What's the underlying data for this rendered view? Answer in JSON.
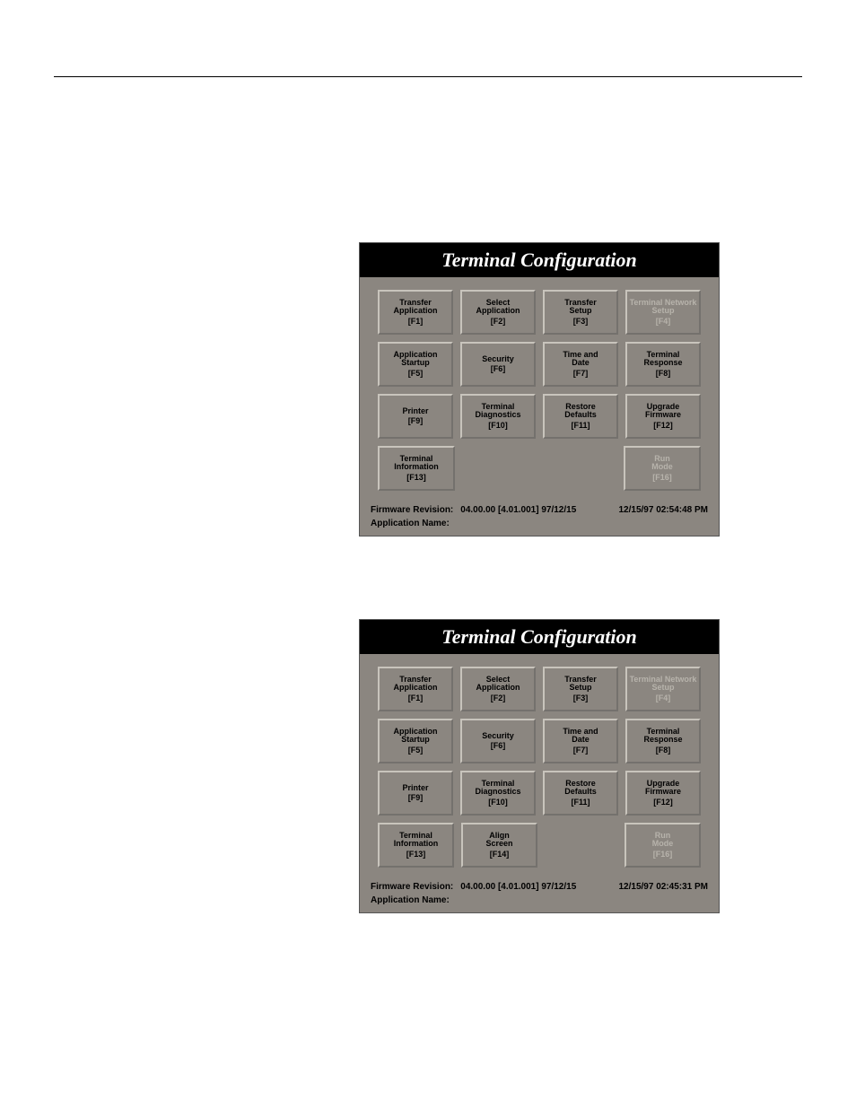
{
  "panels": [
    {
      "title": "Terminal Configuration",
      "rows": [
        [
          {
            "line1": "Transfer",
            "line2": "Application",
            "key": "[F1]",
            "disabled": false
          },
          {
            "line1": "Select",
            "line2": "Application",
            "key": "[F2]",
            "disabled": false
          },
          {
            "line1": "Transfer",
            "line2": "Setup",
            "key": "[F3]",
            "disabled": false
          },
          {
            "line1": "Terminal Network",
            "line2": "Setup",
            "key": "[F4]",
            "disabled": true
          }
        ],
        [
          {
            "line1": "Application",
            "line2": "Startup",
            "key": "[F5]",
            "disabled": false
          },
          {
            "line1": "Security",
            "line2": "",
            "key": "[F6]",
            "disabled": false
          },
          {
            "line1": "Time and",
            "line2": "Date",
            "key": "[F7]",
            "disabled": false
          },
          {
            "line1": "Terminal",
            "line2": "Response",
            "key": "[F8]",
            "disabled": false
          }
        ],
        [
          {
            "line1": "Printer",
            "line2": "",
            "key": "[F9]",
            "disabled": false
          },
          {
            "line1": "Terminal",
            "line2": "Diagnostics",
            "key": "[F10]",
            "disabled": false
          },
          {
            "line1": "Restore",
            "line2": "Defaults",
            "key": "[F11]",
            "disabled": false
          },
          {
            "line1": "Upgrade",
            "line2": "Firmware",
            "key": "[F12]",
            "disabled": false
          }
        ],
        [
          {
            "line1": "Terminal",
            "line2": "Information",
            "key": "[F13]",
            "disabled": false
          },
          {
            "placeholder": true
          },
          {
            "placeholder": true
          },
          {
            "line1": "Run",
            "line2": "Mode",
            "key": "[F16]",
            "disabled": true
          }
        ]
      ],
      "footer": {
        "fw_label": "Firmware Revision:",
        "fw_value": "04.00.00 [4.01.001] 97/12/15",
        "timestamp": "12/15/97  02:54:48 PM",
        "app_label": "Application Name:",
        "app_value": ""
      }
    },
    {
      "title": "Terminal Configuration",
      "rows": [
        [
          {
            "line1": "Transfer",
            "line2": "Application",
            "key": "[F1]",
            "disabled": false
          },
          {
            "line1": "Select",
            "line2": "Application",
            "key": "[F2]",
            "disabled": false
          },
          {
            "line1": "Transfer",
            "line2": "Setup",
            "key": "[F3]",
            "disabled": false
          },
          {
            "line1": "Terminal Network",
            "line2": "Setup",
            "key": "[F4]",
            "disabled": true
          }
        ],
        [
          {
            "line1": "Application",
            "line2": "Startup",
            "key": "[F5]",
            "disabled": false
          },
          {
            "line1": "Security",
            "line2": "",
            "key": "[F6]",
            "disabled": false
          },
          {
            "line1": "Time and",
            "line2": "Date",
            "key": "[F7]",
            "disabled": false
          },
          {
            "line1": "Terminal",
            "line2": "Response",
            "key": "[F8]",
            "disabled": false
          }
        ],
        [
          {
            "line1": "Printer",
            "line2": "",
            "key": "[F9]",
            "disabled": false
          },
          {
            "line1": "Terminal",
            "line2": "Diagnostics",
            "key": "[F10]",
            "disabled": false
          },
          {
            "line1": "Restore",
            "line2": "Defaults",
            "key": "[F11]",
            "disabled": false
          },
          {
            "line1": "Upgrade",
            "line2": "Firmware",
            "key": "[F12]",
            "disabled": false
          }
        ],
        [
          {
            "line1": "Terminal",
            "line2": "Information",
            "key": "[F13]",
            "disabled": false
          },
          {
            "line1": "Align",
            "line2": "Screen",
            "key": "[F14]",
            "disabled": false
          },
          {
            "placeholder": true
          },
          {
            "line1": "Run",
            "line2": "Mode",
            "key": "[F16]",
            "disabled": true
          }
        ]
      ],
      "footer": {
        "fw_label": "Firmware Revision:",
        "fw_value": "04.00.00 [4.01.001] 97/12/15",
        "timestamp": "12/15/97  02:45:31 PM",
        "app_label": "Application Name:",
        "app_value": ""
      }
    }
  ]
}
